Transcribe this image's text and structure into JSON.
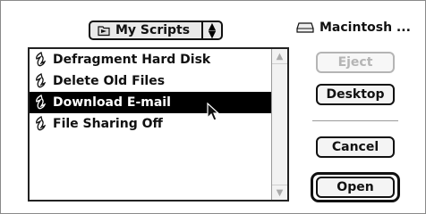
{
  "popup": {
    "label": "My Scripts"
  },
  "disk": {
    "label": "Macintosh ..."
  },
  "files": [
    {
      "name": "Defragment Hard Disk",
      "selected": false
    },
    {
      "name": "Delete Old Files",
      "selected": false
    },
    {
      "name": "Download E-mail",
      "selected": true
    },
    {
      "name": "File Sharing Off",
      "selected": false
    }
  ],
  "buttons": {
    "eject": "Eject",
    "desktop": "Desktop",
    "cancel": "Cancel",
    "open": "Open"
  }
}
